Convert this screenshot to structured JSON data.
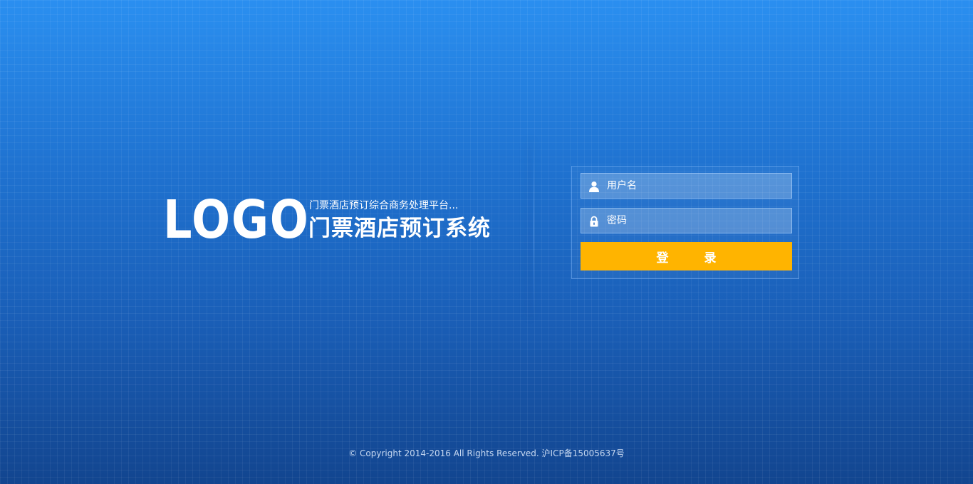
{
  "brand": {
    "logo_text": "LOGO",
    "subtitle": "门票酒店预订综合商务处理平台...",
    "title": "门票酒店预订系统"
  },
  "login": {
    "username_placeholder": "用户名",
    "password_placeholder": "密码",
    "submit_label": "登 录",
    "username_icon": "user-icon",
    "password_icon": "lock-icon"
  },
  "footer": {
    "copyright": "© Copyright 2014-2016 All Rights Reserved.  沪ICP备15005637号"
  },
  "colors": {
    "accent": "#ffb400",
    "background": "#1a62bd"
  }
}
